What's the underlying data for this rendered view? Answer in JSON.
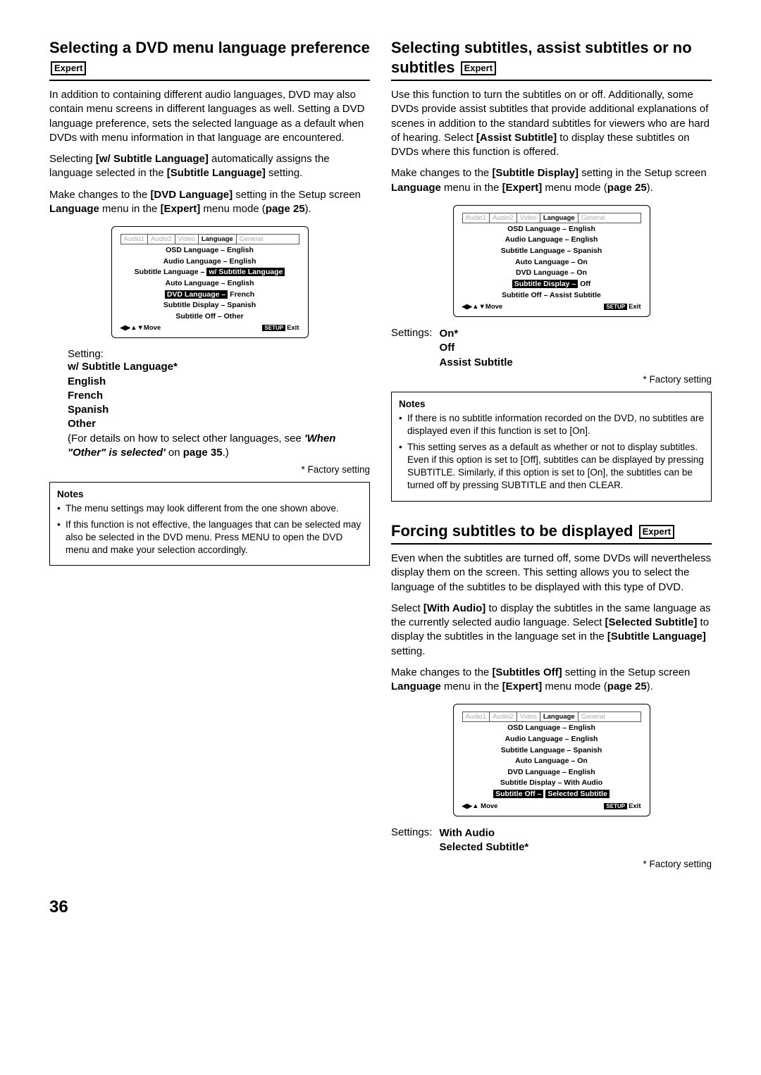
{
  "pageNumber": "36",
  "badges": {
    "expert": "Expert"
  },
  "left": {
    "title": "Selecting a DVD menu language preference",
    "para1": "In addition to containing different audio languages, DVD may also contain menu screens in different languages as well. Setting a DVD language preference, sets the selected language as a default when DVDs with menu information in that language are encountered.",
    "para2a": "Selecting ",
    "para2b": "[w/ Subtitle Language]",
    "para2c": " automatically assigns the language selected in the ",
    "para2d": "[Subtitle Language]",
    "para2e": " setting.",
    "para3a": "Make changes to the ",
    "para3b": "[DVD Language]",
    "para3c": " setting in the Setup screen ",
    "para3d": "Language",
    "para3e": " menu in the ",
    "para3f": "[Expert]",
    "para3g": " menu mode (",
    "para3h": "page 25",
    "para3i": ").",
    "osd": {
      "tabs": [
        "Audio1",
        "Audio2",
        "Video",
        "Language",
        "General"
      ],
      "lines": [
        {
          "l": "OSD Language –",
          "v": "English"
        },
        {
          "l": "Audio Language –",
          "v": "English"
        },
        {
          "l": "Subtitle Language –",
          "v": "w/ Subtitle Language",
          "hl": true
        },
        {
          "l": "Auto Language –",
          "v": "English"
        },
        {
          "l": "DVD Language –",
          "v": "French",
          "row": true
        },
        {
          "l": "Subtitle Display –",
          "v": "Spanish"
        },
        {
          "l": "Subtitle Off –",
          "v": "Other"
        }
      ],
      "footLeft": "◀▶▲▼Move",
      "footSetup": "SETUP",
      "footExit": "Exit"
    },
    "settingLabel": "Setting:",
    "options": [
      "w/ Subtitle Language*",
      "English",
      "French",
      "Spanish",
      "Other"
    ],
    "otherNote1": "(For details on how to select other languages, see ",
    "otherNote2": "'When \"Other\" is selected'",
    "otherNote3": " on ",
    "otherNote4": "page 35",
    "otherNote5": ".)",
    "factory": "* Factory setting",
    "notesTitle": "Notes",
    "notes": [
      "The menu settings may look different from the one shown above.",
      "If this function is not effective, the languages that can be selected may also be selected in the DVD menu. Press MENU to open the DVD menu and make your selection accordingly."
    ]
  },
  "right1": {
    "title": "Selecting subtitles, assist subtitles or no subtitles",
    "p1a": "Use this function to turn the subtitles on or off. Additionally, some DVDs provide assist subtitles that provide additional explanations of scenes in addition to the standard subtitles for viewers who are hard of hearing. Select ",
    "p1b": "[Assist Subtitle]",
    "p1c": " to display these subtitles on DVDs where this function is offered.",
    "p2a": "Make changes to the ",
    "p2b": "[Subtitle Display]",
    "p2c": " setting in the Setup screen ",
    "p2d": "Language",
    "p2e": " menu in the ",
    "p2f": "[Expert]",
    "p2g": " menu mode (",
    "p2h": "page 25",
    "p2i": ").",
    "osd": {
      "tabs": [
        "Audio1",
        "Audio2",
        "Video",
        "Language",
        "General"
      ],
      "lines": [
        {
          "l": "OSD Language –",
          "v": "English"
        },
        {
          "l": "Audio Language –",
          "v": "English"
        },
        {
          "l": "Subtitle Language –",
          "v": "Spanish"
        },
        {
          "l": "Auto Language –",
          "v": "On"
        },
        {
          "l": "DVD Language –",
          "v": "On"
        },
        {
          "l": "Subtitle Display –",
          "v": "Off",
          "row": true
        },
        {
          "l": "Subtitle Off –",
          "v": "Assist Subtitle"
        }
      ],
      "footLeft": "◀▶▲▼Move",
      "footSetup": "SETUP",
      "footExit": "Exit"
    },
    "settingLabel": "Settings:",
    "options": [
      "On*",
      "Off",
      "Assist Subtitle"
    ],
    "factory": "* Factory setting",
    "notesTitle": "Notes",
    "notes": [
      "If there is no subtitle information recorded on the DVD, no subtitles are displayed even if this function is set to [On].",
      "This setting serves as a default as whether or not to display subtitles. Even if this option is set to [Off], subtitles can be displayed by pressing SUBTITLE. Similarly, if this option is set to [On], the subtitles can be turned off by pressing SUBTITLE and then CLEAR."
    ]
  },
  "right2": {
    "title": "Forcing subtitles to be displayed",
    "p1": "Even when the subtitles are turned off, some DVDs will nevertheless display them on the screen. This setting allows you to select the language of the subtitles to be displayed with this type of DVD.",
    "p2a": "Select ",
    "p2b": "[With Audio]",
    "p2c": " to display the subtitles in the same language as the currently selected audio language. Select ",
    "p2d": "[Selected Subtitle]",
    "p2e": " to display the subtitles in the language set in the ",
    "p2f": "[Subtitle Language]",
    "p2g": " setting.",
    "p3a": "Make changes to the ",
    "p3b": "[Subtitles Off]",
    "p3c": " setting in the Setup screen ",
    "p3d": "Language",
    "p3e": " menu in the ",
    "p3f": "[Expert]",
    "p3g": " menu mode (",
    "p3h": "page 25",
    "p3i": ").",
    "osd": {
      "tabs": [
        "Audio1",
        "Audio2",
        "Video",
        "Language",
        "General"
      ],
      "lines": [
        {
          "l": "OSD Language –",
          "v": "English"
        },
        {
          "l": "Audio Language –",
          "v": "English"
        },
        {
          "l": "Subtitle Language –",
          "v": "Spanish"
        },
        {
          "l": "Auto Language –",
          "v": "On"
        },
        {
          "l": "DVD Language –",
          "v": "English"
        },
        {
          "l": "Subtitle Display –",
          "v": "With Audio"
        },
        {
          "l": "Subtitle Off –",
          "v": "Selected Subtitle",
          "row": true
        }
      ],
      "footLeft": "◀▶▲   Move",
      "footSetup": "SETUP",
      "footExit": "Exit"
    },
    "settingLabel": "Settings:",
    "options": [
      "With Audio",
      "Selected Subtitle*"
    ],
    "factory": "* Factory setting"
  }
}
